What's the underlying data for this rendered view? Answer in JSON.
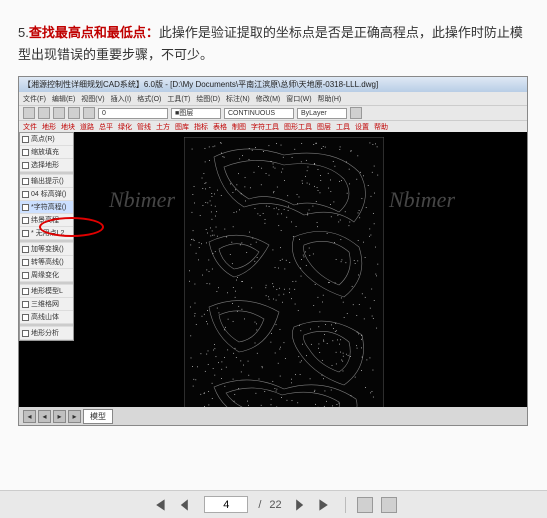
{
  "doc": {
    "number": "5.",
    "highlight": "查找最高点和最低点：",
    "caption_a": "此操作是验证提取的坐标点是否是正确高程点，此操作时防止模型出现错误的重要步骤，不可少。"
  },
  "cad": {
    "title": "【湘源控制性详细规划CAD系统】6.0版 - [D:\\My Documents\\平南江滨原\\总师\\天地原-0318-LLL.dwg]",
    "menus": [
      "文件(F)",
      "编辑(E)",
      "视图(V)",
      "插入(I)",
      "格式(O)",
      "工具(T)",
      "绘图(D)",
      "标注(N)",
      "修改(M)",
      "窗口(W)",
      "帮助(H)"
    ],
    "layer_combo": "0",
    "color_combo": "■图层",
    "linetype_combo": "CONTINUOUS",
    "byweight_combo": "ByLayer",
    "toolbar2_items": [
      "文件",
      "地形",
      "地块",
      "道路",
      "总平",
      "绿化",
      "管线",
      "土方",
      "图库",
      "指标",
      "表格",
      "制图",
      "字符工具",
      "图形工具",
      "图层",
      "工具",
      "设置",
      "帮助"
    ],
    "side_items": [
      {
        "label": "高点(R)",
        "active": false
      },
      {
        "label": "缩放填充",
        "active": false
      },
      {
        "label": "选择地形",
        "active": false
      },
      {
        "label": "[分隔]",
        "active": false
      },
      {
        "label": "输出提示()",
        "active": false
      },
      {
        "label": "04 标高弹()",
        "active": false
      },
      {
        "label": "*字符高程()",
        "active": true
      },
      {
        "label": "纬景高程",
        "active": false
      },
      {
        "label": "* 无用点L2",
        "active": false
      },
      {
        "label": "[分隔]",
        "active": false
      },
      {
        "label": "加等变换()",
        "active": false
      },
      {
        "label": "转等高线()",
        "active": false
      },
      {
        "label": "周缘变化",
        "active": false
      },
      {
        "label": "[分隔]",
        "active": false
      },
      {
        "label": "地形模型L",
        "active": false
      },
      {
        "label": "三维格网",
        "active": false
      },
      {
        "label": "高线山体",
        "active": false
      },
      {
        "label": "[分隔]",
        "active": false
      },
      {
        "label": "地形分析",
        "active": false
      }
    ],
    "tab_label": "模型"
  },
  "watermark": "Nbimer",
  "pager": {
    "current": "4",
    "total": "22"
  }
}
